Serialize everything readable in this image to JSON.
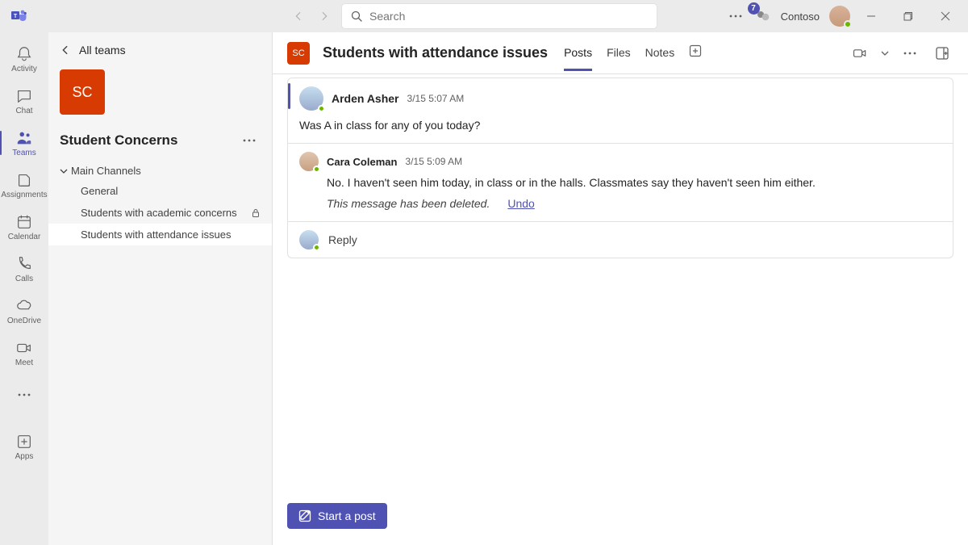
{
  "titlebar": {
    "search_placeholder": "Search",
    "org_name": "Contoso",
    "badge_count": "7"
  },
  "rail": {
    "items": [
      {
        "label": "Activity"
      },
      {
        "label": "Chat"
      },
      {
        "label": "Teams"
      },
      {
        "label": "Assignments"
      },
      {
        "label": "Calendar"
      },
      {
        "label": "Calls"
      },
      {
        "label": "OneDrive"
      },
      {
        "label": "Meet"
      }
    ],
    "apps_label": "Apps"
  },
  "sidepanel": {
    "all_teams_label": "All teams",
    "team_initials": "SC",
    "team_name": "Student Concerns",
    "group_label": "Main Channels",
    "channels": [
      {
        "name": "General"
      },
      {
        "name": "Students with academic concerns"
      },
      {
        "name": "Students with attendance issues"
      }
    ]
  },
  "channel_header": {
    "tile_initials": "SC",
    "title": "Students with attendance issues",
    "tabs": [
      {
        "label": "Posts"
      },
      {
        "label": "Files"
      },
      {
        "label": "Notes"
      }
    ]
  },
  "post": {
    "author": "Arden Asher",
    "timestamp": "3/15 5:07 AM",
    "body": "Was A in class for any of you today?",
    "reply": {
      "author": "Cara Coleman",
      "timestamp": "3/15 5:09 AM",
      "body": "No. I haven't seen him today, in class or in the halls. Classmates say they haven't seen him either."
    },
    "deleted_label": "This message has been deleted.",
    "undo_label": "Undo",
    "reply_label": "Reply"
  },
  "composer": {
    "start_post_label": "Start a post"
  }
}
